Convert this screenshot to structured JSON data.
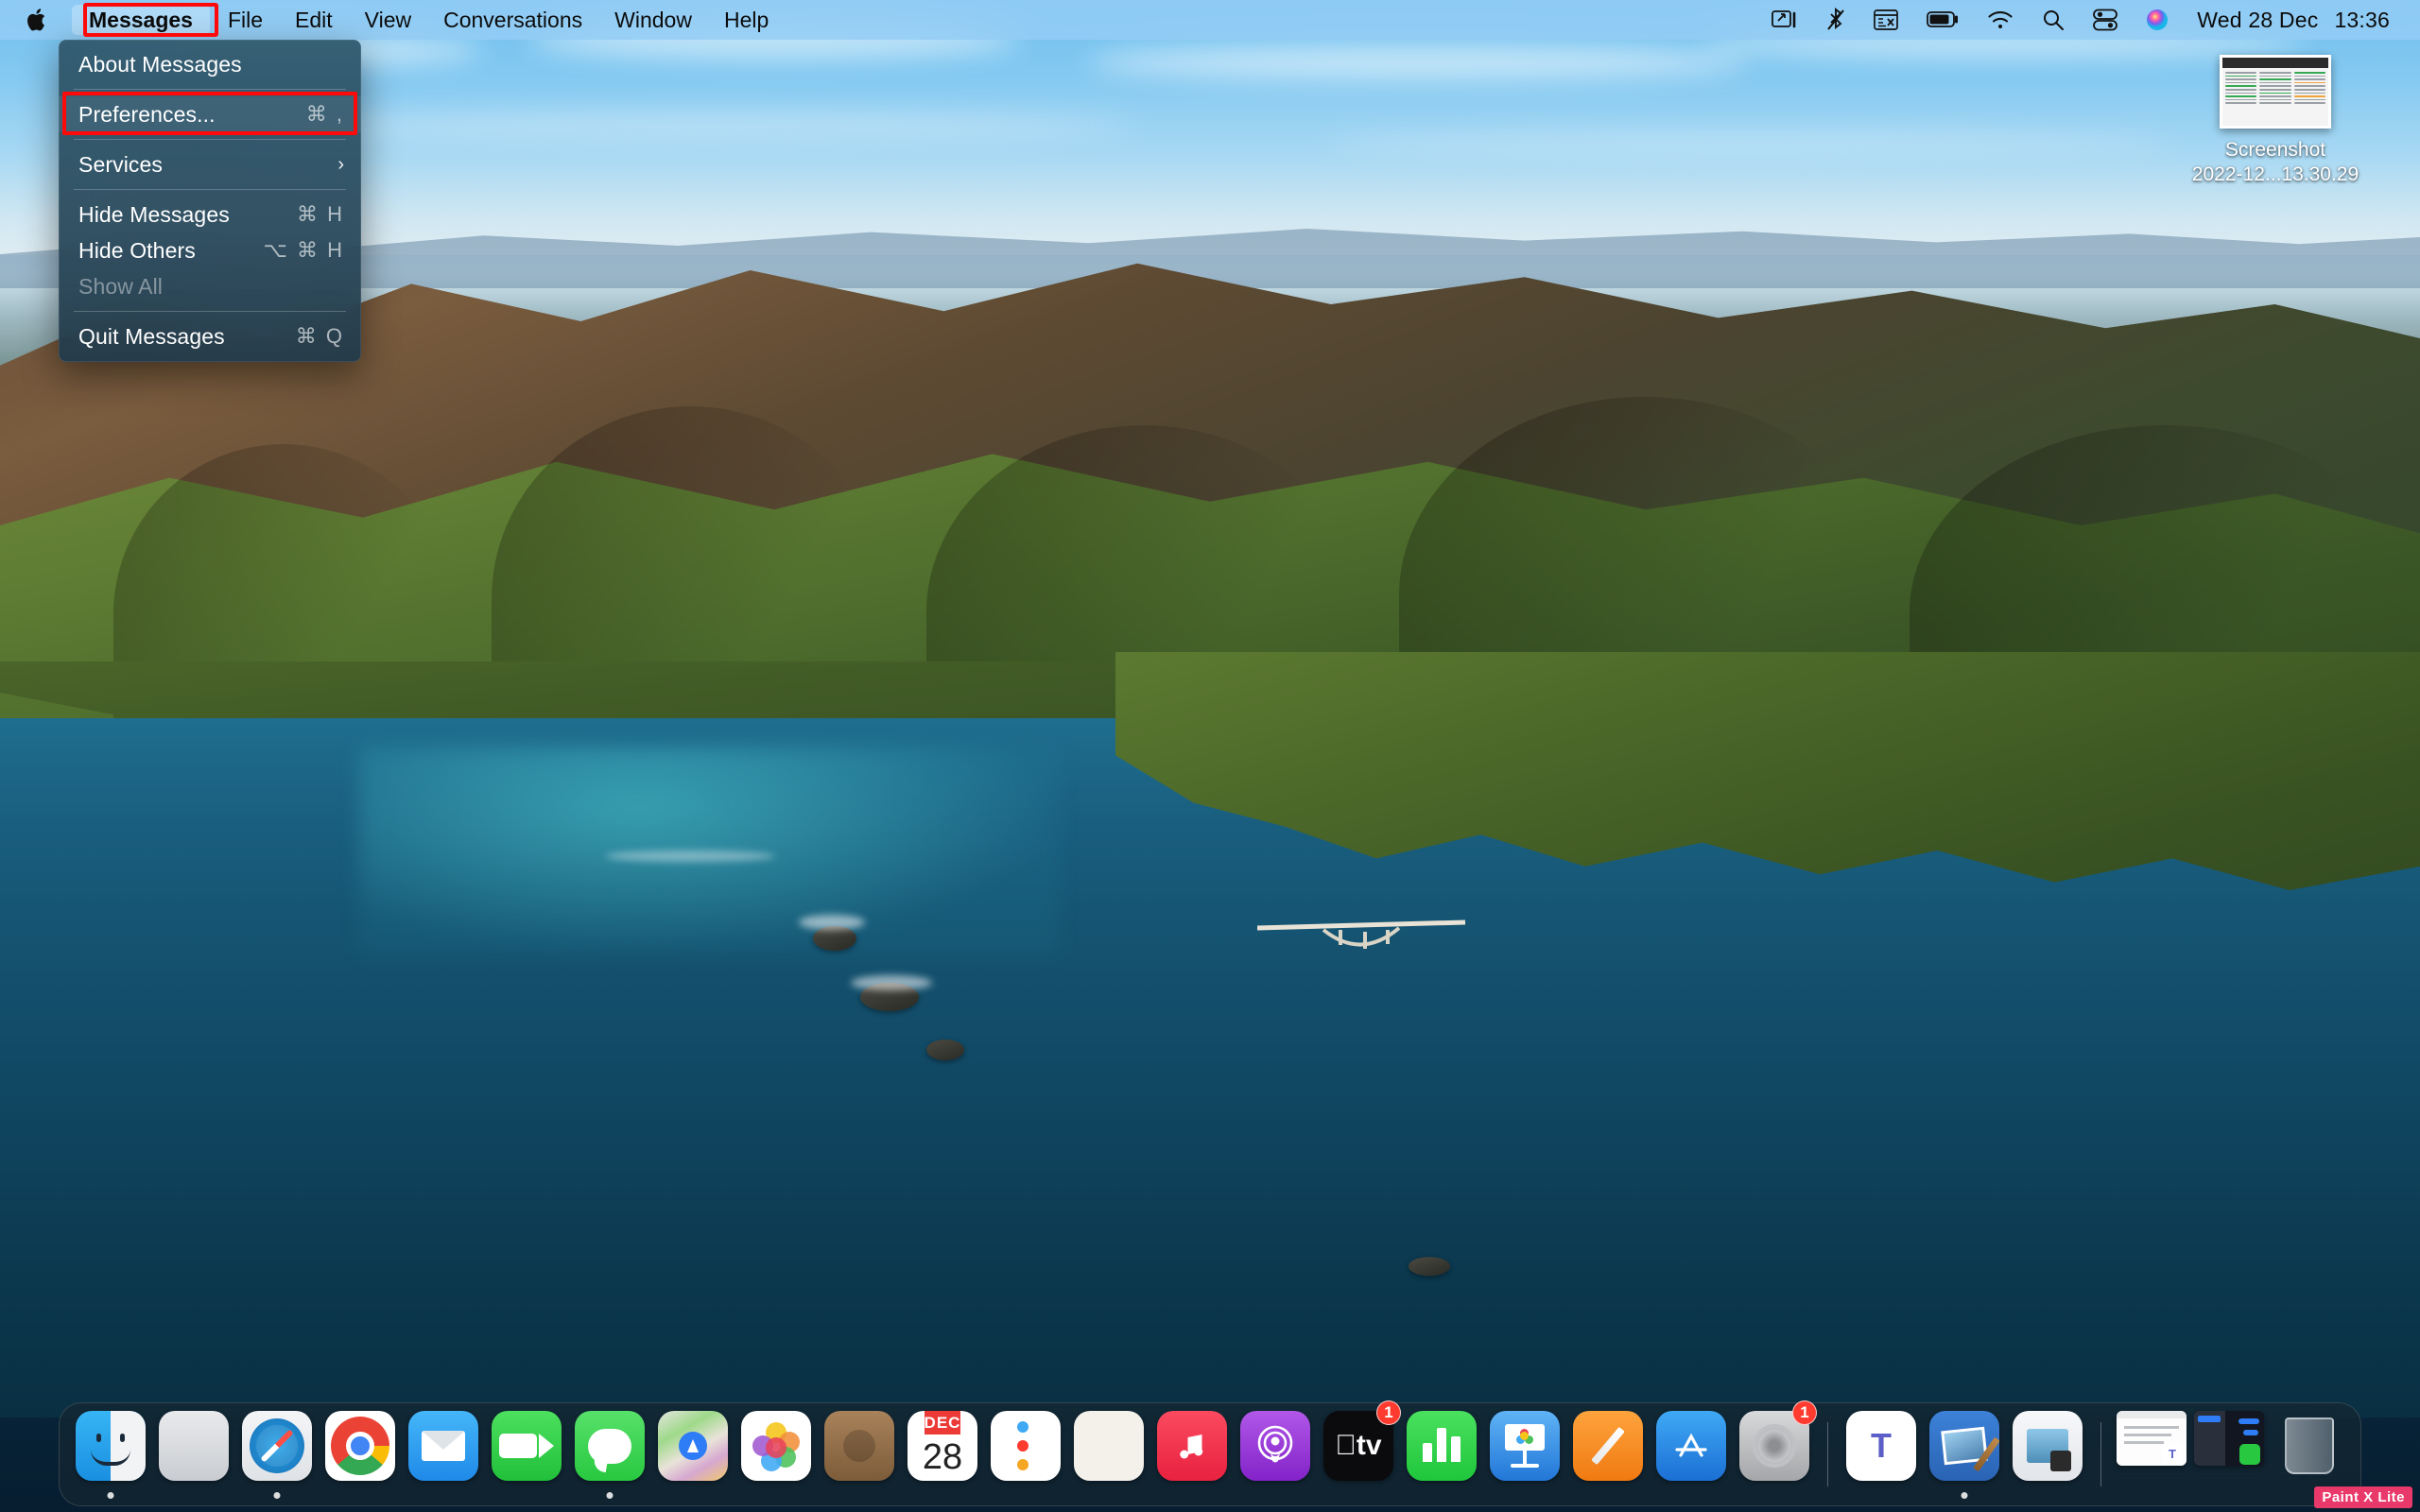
{
  "menubar": {
    "apple_icon": "apple-logo-icon",
    "items": [
      {
        "label": "Messages",
        "active": true
      },
      {
        "label": "File",
        "active": false
      },
      {
        "label": "Edit",
        "active": false
      },
      {
        "label": "View",
        "active": false
      },
      {
        "label": "Conversations",
        "active": false
      },
      {
        "label": "Window",
        "active": false
      },
      {
        "label": "Help",
        "active": false
      }
    ],
    "status_icons": [
      {
        "name": "screen-mirroring-icon",
        "glyph": "⎐"
      },
      {
        "name": "bluetooth-off-icon",
        "glyph": "ᛦ"
      },
      {
        "name": "input-source-icon",
        "glyph": "⌸"
      },
      {
        "name": "battery-icon",
        "glyph": "▮"
      },
      {
        "name": "wifi-icon",
        "glyph": "◠"
      },
      {
        "name": "search-icon",
        "glyph": "⌕"
      },
      {
        "name": "control-center-icon",
        "glyph": "☰"
      },
      {
        "name": "siri-icon",
        "glyph": "●"
      }
    ],
    "date": "Wed 28 Dec",
    "time": "13:36"
  },
  "app_menu": {
    "title": "Messages",
    "rows": [
      {
        "label": "About Messages",
        "shortcut": "",
        "type": "item",
        "disabled": false,
        "highlighted": false
      },
      {
        "type": "separator"
      },
      {
        "label": "Preferences...",
        "shortcut": "⌘ ,",
        "type": "item",
        "disabled": false,
        "highlighted": true
      },
      {
        "type": "separator"
      },
      {
        "label": "Services",
        "shortcut": "›",
        "type": "submenu",
        "disabled": false,
        "highlighted": false
      },
      {
        "type": "separator"
      },
      {
        "label": "Hide Messages",
        "shortcut": "⌘ H",
        "type": "item",
        "disabled": false,
        "highlighted": false
      },
      {
        "label": "Hide Others",
        "shortcut": "⌥ ⌘ H",
        "type": "item",
        "disabled": false,
        "highlighted": false
      },
      {
        "label": "Show All",
        "shortcut": "",
        "type": "item",
        "disabled": true,
        "highlighted": false
      },
      {
        "type": "separator"
      },
      {
        "label": "Quit Messages",
        "shortcut": "⌘ Q",
        "type": "item",
        "disabled": false,
        "highlighted": false
      }
    ]
  },
  "highlight_color": "#ff0a0a",
  "desktop": {
    "file_icon": {
      "name": "screenshot-file-icon",
      "label_line1": "Screenshot",
      "label_line2": "2022-12...13.30.29"
    }
  },
  "dock": {
    "items": [
      {
        "name": "finder",
        "label": "Finder",
        "running": true,
        "badge": ""
      },
      {
        "name": "launchpad",
        "label": "Launchpad",
        "running": false,
        "badge": ""
      },
      {
        "name": "safari",
        "label": "Safari",
        "running": true,
        "badge": ""
      },
      {
        "name": "chrome",
        "label": "Google Chrome",
        "running": false,
        "badge": ""
      },
      {
        "name": "mail",
        "label": "Mail",
        "running": false,
        "badge": ""
      },
      {
        "name": "facetime",
        "label": "FaceTime",
        "running": false,
        "badge": ""
      },
      {
        "name": "messages",
        "label": "Messages",
        "running": true,
        "badge": ""
      },
      {
        "name": "maps",
        "label": "Maps",
        "running": false,
        "badge": ""
      },
      {
        "name": "photos",
        "label": "Photos",
        "running": false,
        "badge": ""
      },
      {
        "name": "contacts",
        "label": "Contacts",
        "running": false,
        "badge": ""
      },
      {
        "name": "calendar",
        "label": "Calendar",
        "running": false,
        "badge": "",
        "cal_month": "DEC",
        "cal_day": "28"
      },
      {
        "name": "reminders",
        "label": "Reminders",
        "running": false,
        "badge": ""
      },
      {
        "name": "notes",
        "label": "Notes",
        "running": false,
        "badge": ""
      },
      {
        "name": "music",
        "label": "Music",
        "running": false,
        "badge": ""
      },
      {
        "name": "podcasts",
        "label": "Podcasts",
        "running": false,
        "badge": ""
      },
      {
        "name": "appletv",
        "label": "TV",
        "running": false,
        "badge": "1"
      },
      {
        "name": "numbers",
        "label": "Numbers",
        "running": false,
        "badge": ""
      },
      {
        "name": "keynote",
        "label": "Keynote",
        "running": false,
        "badge": ""
      },
      {
        "name": "pages",
        "label": "Pages",
        "running": false,
        "badge": ""
      },
      {
        "name": "appstore",
        "label": "App Store",
        "running": false,
        "badge": ""
      },
      {
        "name": "system-preferences",
        "label": "System Preferences",
        "running": false,
        "badge": "1"
      },
      {
        "name": "teams",
        "label": "Microsoft Teams",
        "running": false,
        "badge": ""
      },
      {
        "name": "paint-x-lite",
        "label": "Paint X Lite",
        "running": true,
        "badge": ""
      },
      {
        "name": "preview",
        "label": "Preview",
        "running": true,
        "badge": ""
      }
    ],
    "minimized": [
      {
        "name": "minimized-window-teams",
        "label": "Teams window"
      },
      {
        "name": "minimized-window-messages",
        "label": "Messages window"
      }
    ],
    "trash": {
      "name": "trash",
      "label": "Trash"
    },
    "tooltip": "Paint X Lite"
  }
}
